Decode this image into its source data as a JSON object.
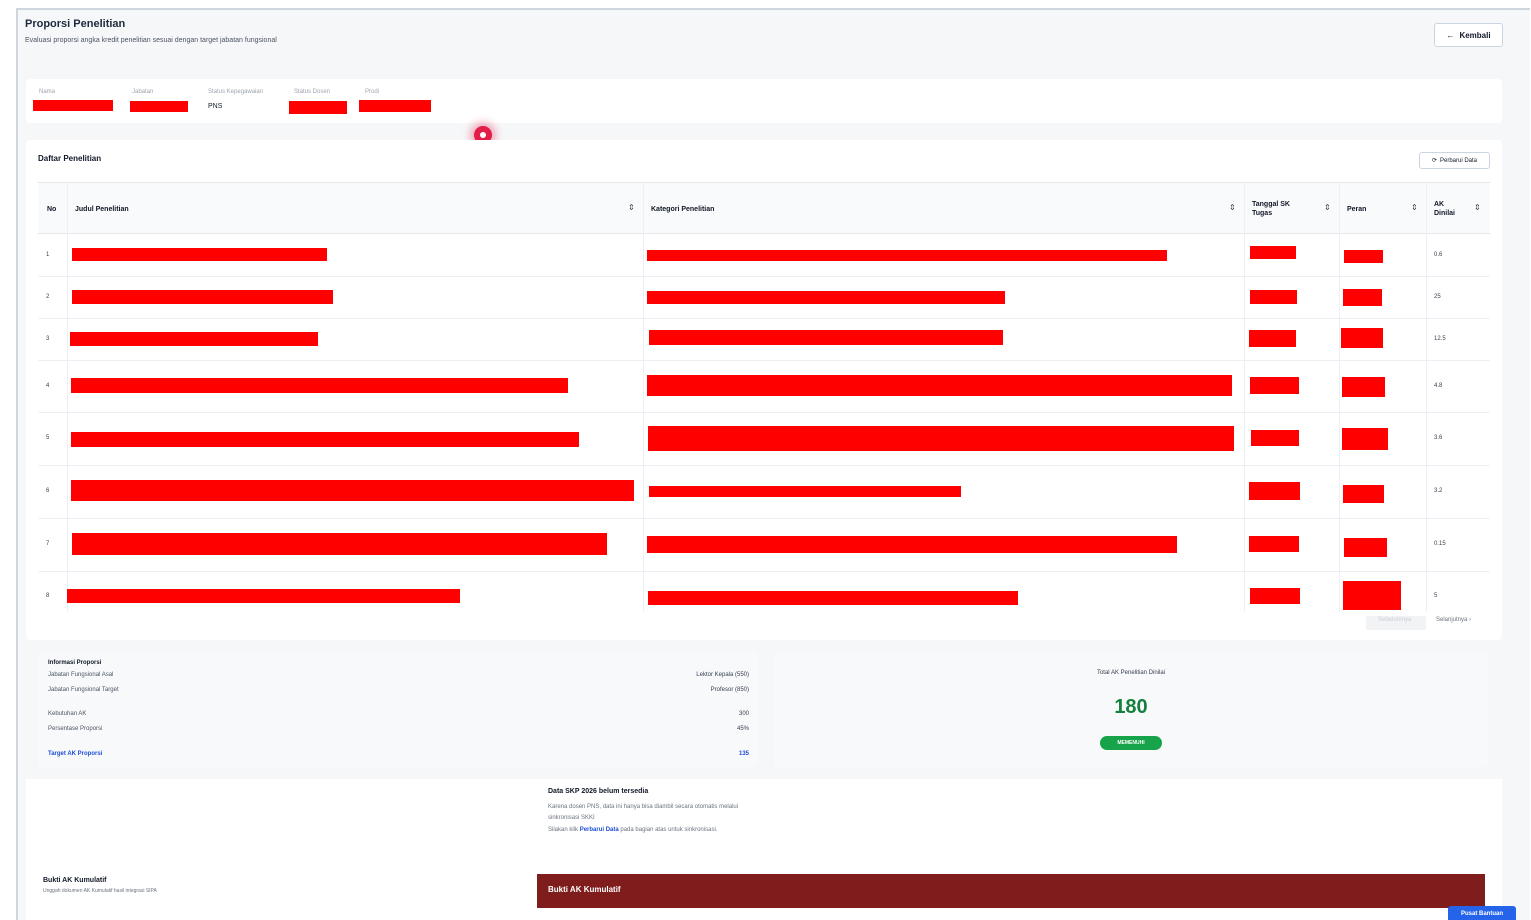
{
  "header": {
    "title": "Proporsi Penelitian",
    "subtitle": "Evaluasi proporsi angka kredit penelitian sesuai dengan target jabatan fungsional",
    "back_label": "Kembali",
    "back_icon": "arrow-left-icon"
  },
  "profile": {
    "fields": [
      {
        "label": "Nama",
        "value": ""
      },
      {
        "label": "Jabatan",
        "value": ""
      },
      {
        "label": "Status Kepegawaian",
        "value": "PNS"
      },
      {
        "label": "Status Dosen",
        "value": ""
      },
      {
        "label": "Prodi",
        "value": ""
      }
    ]
  },
  "table_card": {
    "title": "Daftar Penelitian",
    "refresh_label": "Perbarui Data",
    "refresh_icon": "refresh-icon",
    "columns": [
      "No",
      "Judul Penelitian",
      "Kategori Penelitian",
      "Tanggal SK Tugas",
      "Peran",
      "AK Dinilai"
    ],
    "rows": [
      {
        "no": "1",
        "ak": "0.6"
      },
      {
        "no": "2",
        "ak": "25"
      },
      {
        "no": "3",
        "ak": "12.5"
      },
      {
        "no": "4",
        "ak": "4.8"
      },
      {
        "no": "5",
        "ak": "3.6"
      },
      {
        "no": "6",
        "ak": "3.2"
      },
      {
        "no": "7",
        "ak": "0.15"
      },
      {
        "no": "8",
        "ak": "5"
      }
    ],
    "pager": {
      "prev": "Sebelumnya",
      "next": "Selanjutnya"
    }
  },
  "info": {
    "title": "Informasi Proporsi",
    "items": [
      {
        "label": "Jabatan Fungsional Asal",
        "value": "Lektor Kepala (550)"
      },
      {
        "label": "Jabatan Fungsional Target",
        "value": "Profesor (850)"
      },
      {
        "label": "Kebutuhan AK",
        "value": "300"
      },
      {
        "label": "Persentase Proporsi",
        "value": "45%"
      }
    ],
    "target_label": "Target AK Proporsi",
    "target_value": "135"
  },
  "total": {
    "label": "Total AK Penelitian Dinilai",
    "value": "180",
    "status": "MEMENUHI"
  },
  "skp": {
    "title": "Data SKP 2026 belum tersedia",
    "line1": "Karena dosen PNS, data ini hanya bisa diambil secara otomatis melalui",
    "line2": "sinkronisasi SKKI",
    "line3_pre": "Silakan klik",
    "line3_link": "Perbarui Data",
    "line3_post": "pada bagian atas untuk sinkronisasi."
  },
  "bukti": {
    "title": "Bukti AK Kumulatif",
    "subtitle": "Unggah dokumen AK Kumulatif hasil integrasi SIPA",
    "bar_title": "Bukti AK Kumulatif"
  },
  "help_label": "Pusat Bantuan",
  "colors": {
    "redaction": "#ff0000",
    "success": "#16a34a",
    "maroon": "#7f1d1d",
    "link": "#1d4ed8"
  }
}
